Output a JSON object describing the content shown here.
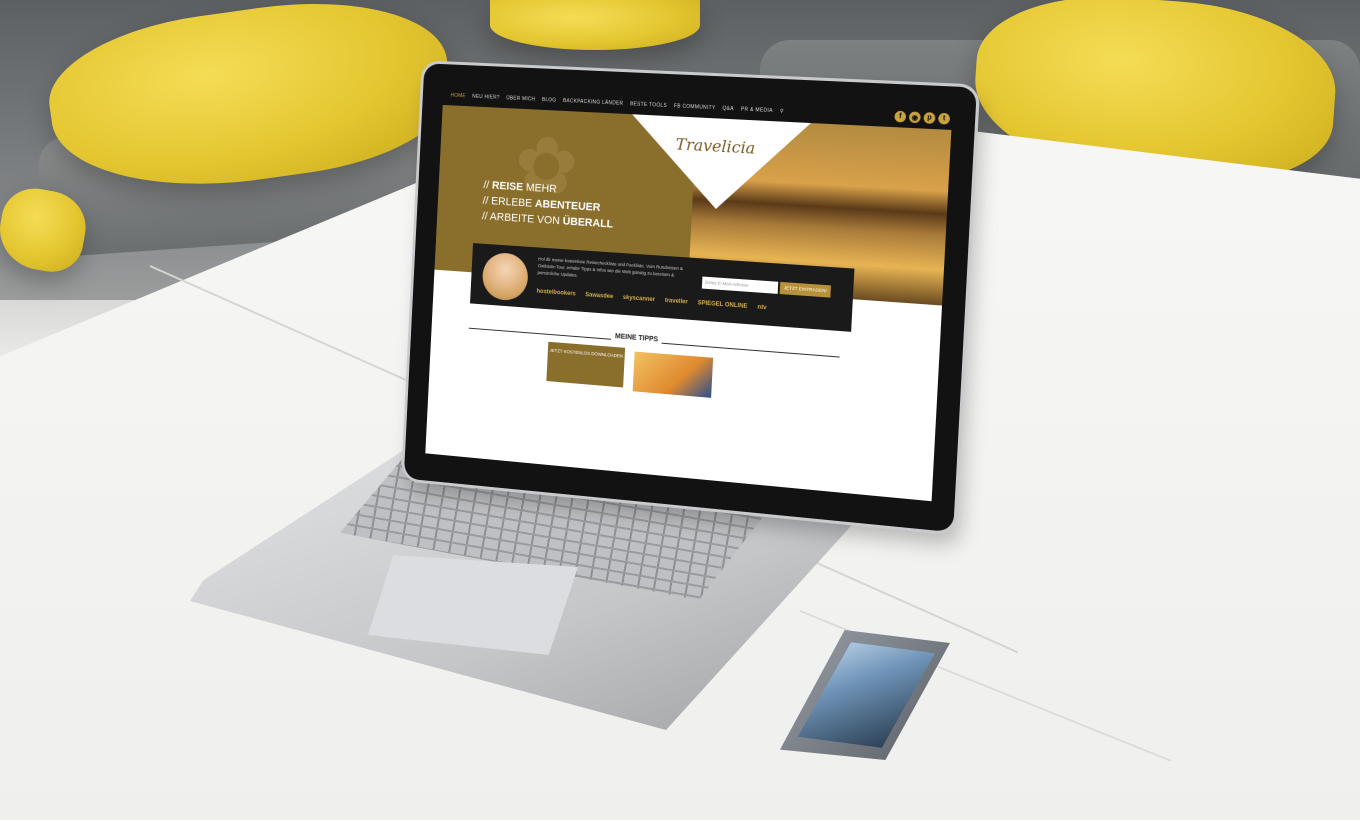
{
  "nav": {
    "items": [
      "HOME",
      "NEU HIER?",
      "ÜBER MICH",
      "BLOG",
      "BACKPACKING LÄNDER",
      "BESTE TOOLS",
      "FB COMMUNITY",
      "Q&A",
      "PR & MEDIA"
    ]
  },
  "brand": {
    "logo": "Travelicia"
  },
  "hero": {
    "line1_prefix": "// ",
    "line1_bold": "REISE",
    "line1_rest": " MEHR",
    "line2_prefix": "// ERLEBE ",
    "line2_bold": "ABENTEUER",
    "line3_prefix": "// ARBEITE VON ",
    "line3_bold": "ÜBERALL"
  },
  "newsletter": {
    "text": "Hol dir meine kostenlose Reisecheckliste und Packliste. Vom Rundreisen & Ostküste-Tour, erhalte Tipps & Infos wie die Welt günstig zu bereisen & persönliche Updates.",
    "placeholder": "Deine E-Mail-Adresse",
    "button": "JETZT EINTRAGEN!"
  },
  "partners": [
    "hostelbookers",
    "Sawasdee",
    "skyscanner",
    "traveller",
    "SPIEGEL ONLINE",
    "ntv"
  ],
  "tips": {
    "heading": "MEINE TIPPS",
    "card_text": "JETZT KOSTENLOS DOWNLOADEN"
  },
  "icons": [
    "facebook-icon",
    "instagram-icon",
    "pinterest-icon",
    "twitter-icon",
    "search-icon"
  ],
  "colors": {
    "accent": "#c8a23c",
    "hero_bg": "#8a6e2c",
    "nav_bg": "#121212"
  }
}
